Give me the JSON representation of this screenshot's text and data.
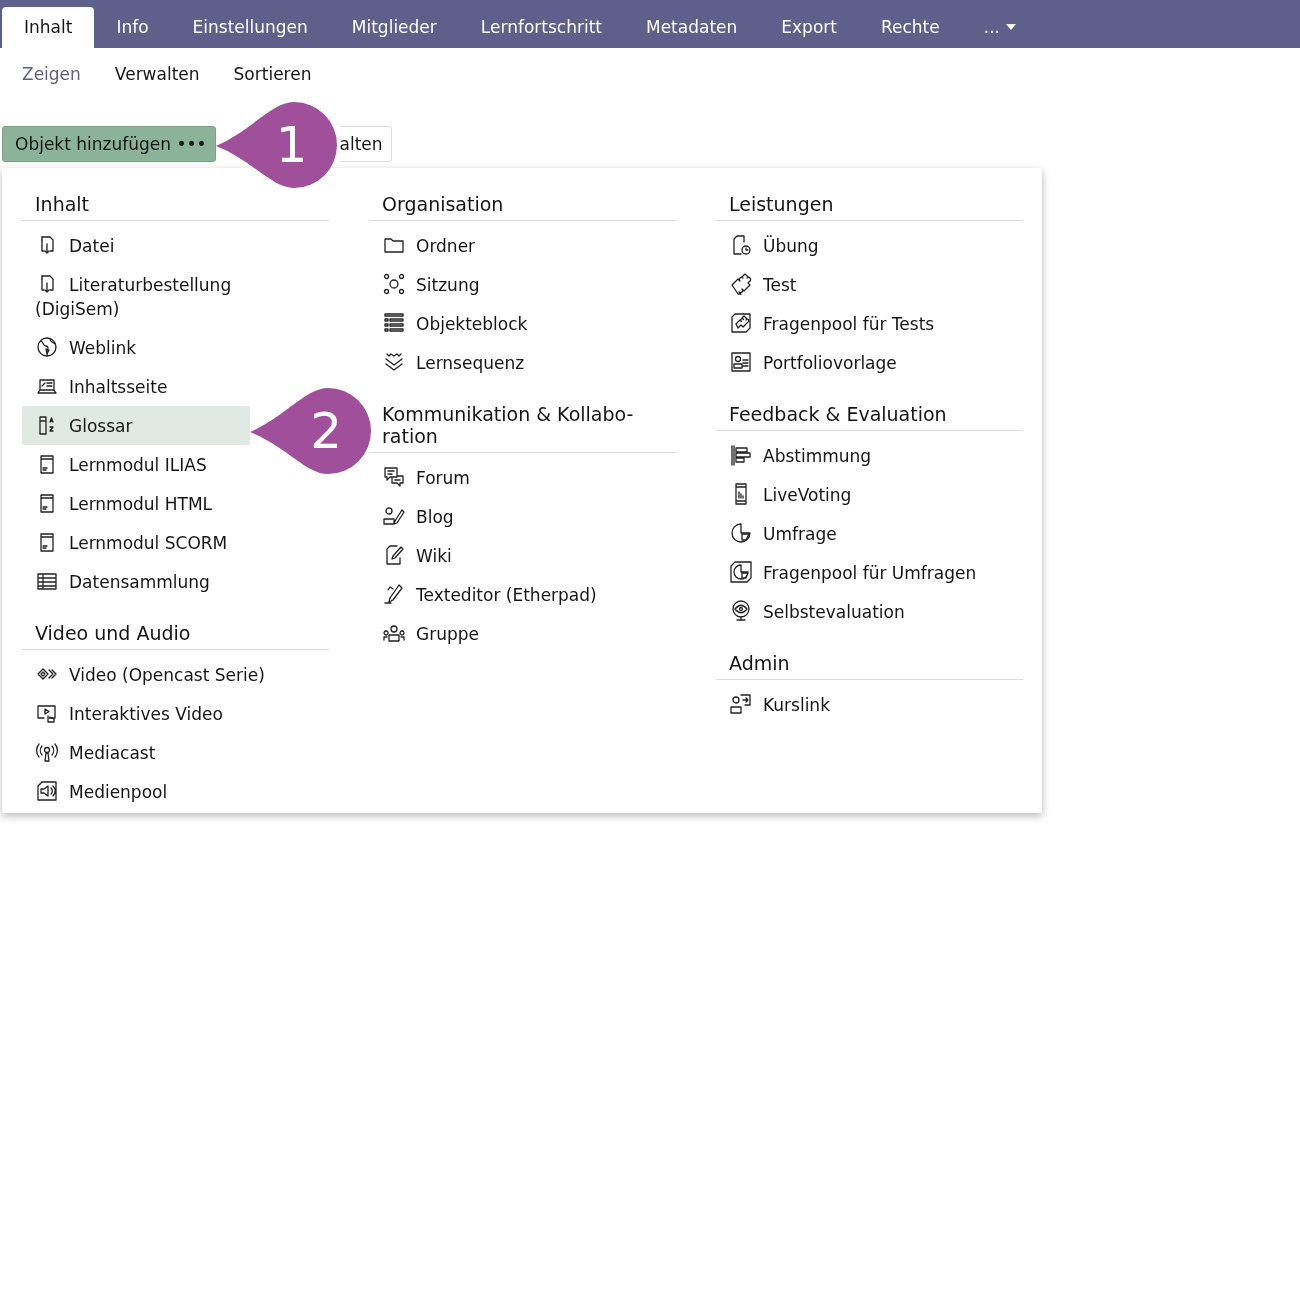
{
  "tabs": [
    {
      "label": "Inhalt",
      "selected": true,
      "kind": "tab"
    },
    {
      "label": "Info",
      "selected": false,
      "kind": "tab"
    },
    {
      "label": "Einstellungen",
      "selected": false,
      "kind": "tab"
    },
    {
      "label": "Mitglieder",
      "selected": false,
      "kind": "tab"
    },
    {
      "label": "Lernfortschritt",
      "selected": false,
      "kind": "tab"
    },
    {
      "label": "Metadaten",
      "selected": false,
      "kind": "tab"
    },
    {
      "label": "Export",
      "selected": false,
      "kind": "tab"
    },
    {
      "label": "Rechte",
      "selected": false,
      "kind": "tab"
    },
    {
      "label": "...",
      "selected": false,
      "kind": "more"
    }
  ],
  "subtabs": [
    {
      "label": "Zeigen",
      "selected": true
    },
    {
      "label": "Verwalten",
      "selected": false
    },
    {
      "label": "Sortieren",
      "selected": false
    }
  ],
  "toolbar": [
    {
      "label": "Objekt hinzufügen •••",
      "kind": "primary"
    },
    {
      "label": "alten",
      "kind": "secondary"
    }
  ],
  "menu": {
    "columns": [
      {
        "groups": [
          {
            "title": "Inhalt",
            "items": [
              {
                "label": "Datei",
                "selected": false
              },
              {
                "label": "Literaturbestellung (DigiSem)",
                "selected": false
              },
              {
                "label": "Weblink",
                "selected": false
              },
              {
                "label": "Inhaltsseite",
                "selected": false
              },
              {
                "label": "Glossar",
                "selected": true
              },
              {
                "label": "Lernmodul ILIAS",
                "selected": false
              },
              {
                "label": "Lernmodul HTML",
                "selected": false
              },
              {
                "label": "Lernmodul SCORM",
                "selected": false
              },
              {
                "label": "Datensammlung",
                "selected": false
              }
            ]
          },
          {
            "title": "Video und Audio",
            "items": [
              {
                "label": "Video (Opencast Serie)",
                "selected": false
              },
              {
                "label": "Interaktives Video",
                "selected": false
              },
              {
                "label": "Mediacast",
                "selected": false
              },
              {
                "label": "Medienpool",
                "selected": false
              }
            ]
          }
        ]
      },
      {
        "groups": [
          {
            "title": "Organisation",
            "items": [
              {
                "label": "Ordner",
                "selected": false
              },
              {
                "label": "Sitzung",
                "selected": false
              },
              {
                "label": "Objekteblock",
                "selected": false
              },
              {
                "label": "Lernsequenz",
                "selected": false
              }
            ]
          },
          {
            "title": "Kommunikation & Kollabo-ration",
            "items": [
              {
                "label": "Forum",
                "selected": false
              },
              {
                "label": "Blog",
                "selected": false
              },
              {
                "label": "Wiki",
                "selected": false
              },
              {
                "label": "Texteditor (Etherpad)",
                "selected": false
              },
              {
                "label": "Gruppe",
                "selected": false
              }
            ]
          }
        ]
      },
      {
        "groups": [
          {
            "title": "Leistungen",
            "items": [
              {
                "label": "Übung",
                "selected": false
              },
              {
                "label": "Test",
                "selected": false
              },
              {
                "label": "Fragenpool für Tests",
                "selected": false
              },
              {
                "label": "Portfoliovorlage",
                "selected": false
              }
            ]
          },
          {
            "title": "Feedback & Evaluation",
            "items": [
              {
                "label": "Abstimmung",
                "selected": false
              },
              {
                "label": "LiveVoting",
                "selected": false
              },
              {
                "label": "Umfrage",
                "selected": false
              },
              {
                "label": "Fragenpool für Umfragen",
                "selected": false
              },
              {
                "label": "Selbstevaluation",
                "selected": false
              }
            ]
          },
          {
            "title": "Admin",
            "items": [
              {
                "label": "Kurslink",
                "selected": false
              }
            ]
          }
        ]
      }
    ]
  },
  "callouts": [
    {
      "label": "1"
    },
    {
      "label": "2"
    }
  ]
}
